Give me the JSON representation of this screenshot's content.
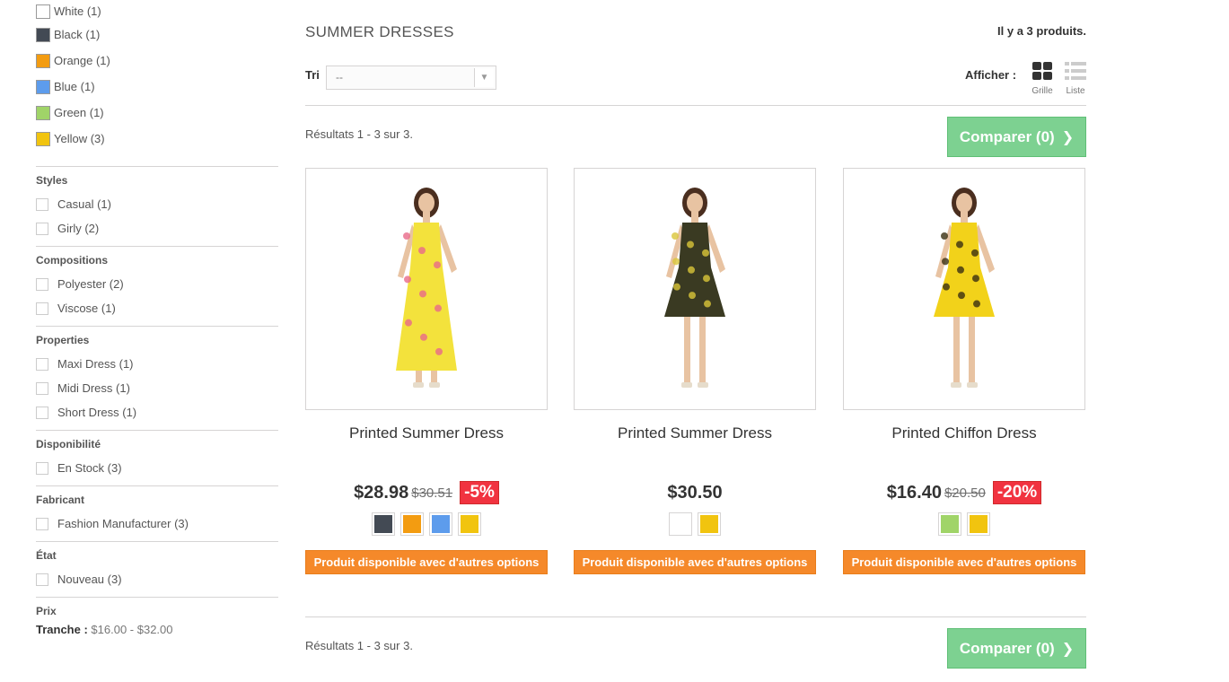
{
  "sidebar": {
    "colors": [
      {
        "label": "White (1)",
        "hex": "#ffffff"
      },
      {
        "label": "Black (1)",
        "hex": "#434a54"
      },
      {
        "label": "Orange (1)",
        "hex": "#f39c11"
      },
      {
        "label": "Blue (1)",
        "hex": "#5d9cec"
      },
      {
        "label": "Green (1)",
        "hex": "#a0d468"
      },
      {
        "label": "Yellow (3)",
        "hex": "#f1c40f"
      }
    ],
    "groups": [
      {
        "title": "Styles",
        "items": [
          "Casual (1)",
          "Girly (2)"
        ]
      },
      {
        "title": "Compositions",
        "items": [
          "Polyester (2)",
          "Viscose (1)"
        ]
      },
      {
        "title": "Properties",
        "items": [
          "Maxi Dress (1)",
          "Midi Dress (1)",
          "Short Dress (1)"
        ]
      },
      {
        "title": "Disponibilité",
        "items": [
          "En Stock (3)"
        ]
      },
      {
        "title": "Fabricant",
        "items": [
          "Fashion Manufacturer (3)"
        ]
      },
      {
        "title": "État",
        "items": [
          "Nouveau (3)"
        ]
      }
    ],
    "price": {
      "title": "Prix",
      "range_label": "Tranche :",
      "range_value": "$16.00 - $32.00"
    }
  },
  "main": {
    "title": "SUMMER DRESSES",
    "product_count": "Il y a 3 produits.",
    "sort_label": "Tri",
    "sort_value": "--",
    "view_label": "Afficher :",
    "view_grid": "Grille",
    "view_list": "Liste",
    "results_text": "Résultats 1 - 3 sur 3.",
    "compare_label": "Comparer (0)"
  },
  "products": [
    {
      "name": "Printed Summer Dress",
      "price": "$28.98",
      "old_price": "$30.51",
      "discount": "-5%",
      "swatches": [
        "#434a54",
        "#f39c11",
        "#5d9cec",
        "#f1c40f"
      ],
      "options_label": "Produit disponible avec d'autres options",
      "dress_color": "#f3e23c",
      "pattern_color": "#e86a8a"
    },
    {
      "name": "Printed Summer Dress",
      "price": "$30.50",
      "old_price": "",
      "discount": "",
      "swatches": [
        "#ffffff",
        "#f1c40f"
      ],
      "options_label": "Produit disponible avec d'autres options",
      "dress_color": "#3a3a22",
      "pattern_color": "#d9c63a"
    },
    {
      "name": "Printed Chiffon Dress",
      "price": "$16.40",
      "old_price": "$20.50",
      "discount": "-20%",
      "swatches": [
        "#a0d468",
        "#f1c40f"
      ],
      "options_label": "Produit disponible avec d'autres options",
      "dress_color": "#f2d21a",
      "pattern_color": "#3a2f12"
    }
  ]
}
